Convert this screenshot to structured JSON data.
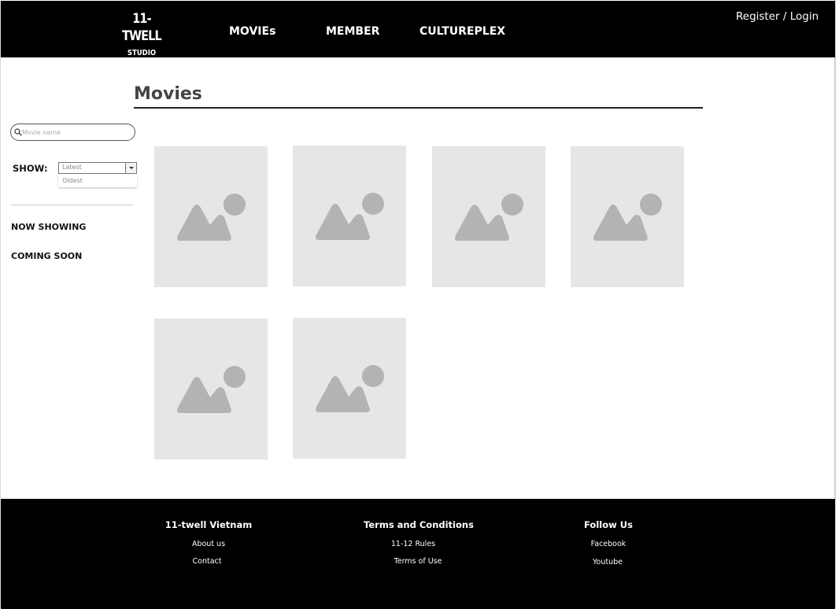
{
  "header": {
    "logo_main": "11-TWELL",
    "logo_sub": "STUDIO",
    "nav": [
      "MOVIEs",
      "MEMBER",
      "CULTUREPLEX"
    ],
    "auth": "Register / Login"
  },
  "page": {
    "title": "Movies"
  },
  "sidebar": {
    "search_placeholder": "Movie name",
    "show_label": "SHOW:",
    "sort_selected": "Latest",
    "sort_options": [
      "Latest",
      "Oldest"
    ],
    "links": [
      "NOW SHOWING",
      "COMING SOON"
    ]
  },
  "movies": {
    "count": 6,
    "placeholder_icon": "image-placeholder-icon"
  },
  "footer": {
    "columns": [
      {
        "heading": "11-twell Vietnam",
        "links": [
          "About us",
          "Contact"
        ]
      },
      {
        "heading": "Terms and Conditions",
        "links": [
          "11-12 Rules",
          "Terms of Use"
        ]
      },
      {
        "heading": "Follow Us",
        "links": [
          "Facebook",
          "Youtube"
        ]
      }
    ]
  },
  "colors": {
    "header_bg": "#000000",
    "card_bg": "#e6e6e6",
    "placeholder_icon": "#b3b3b3",
    "title_text": "#444444"
  }
}
